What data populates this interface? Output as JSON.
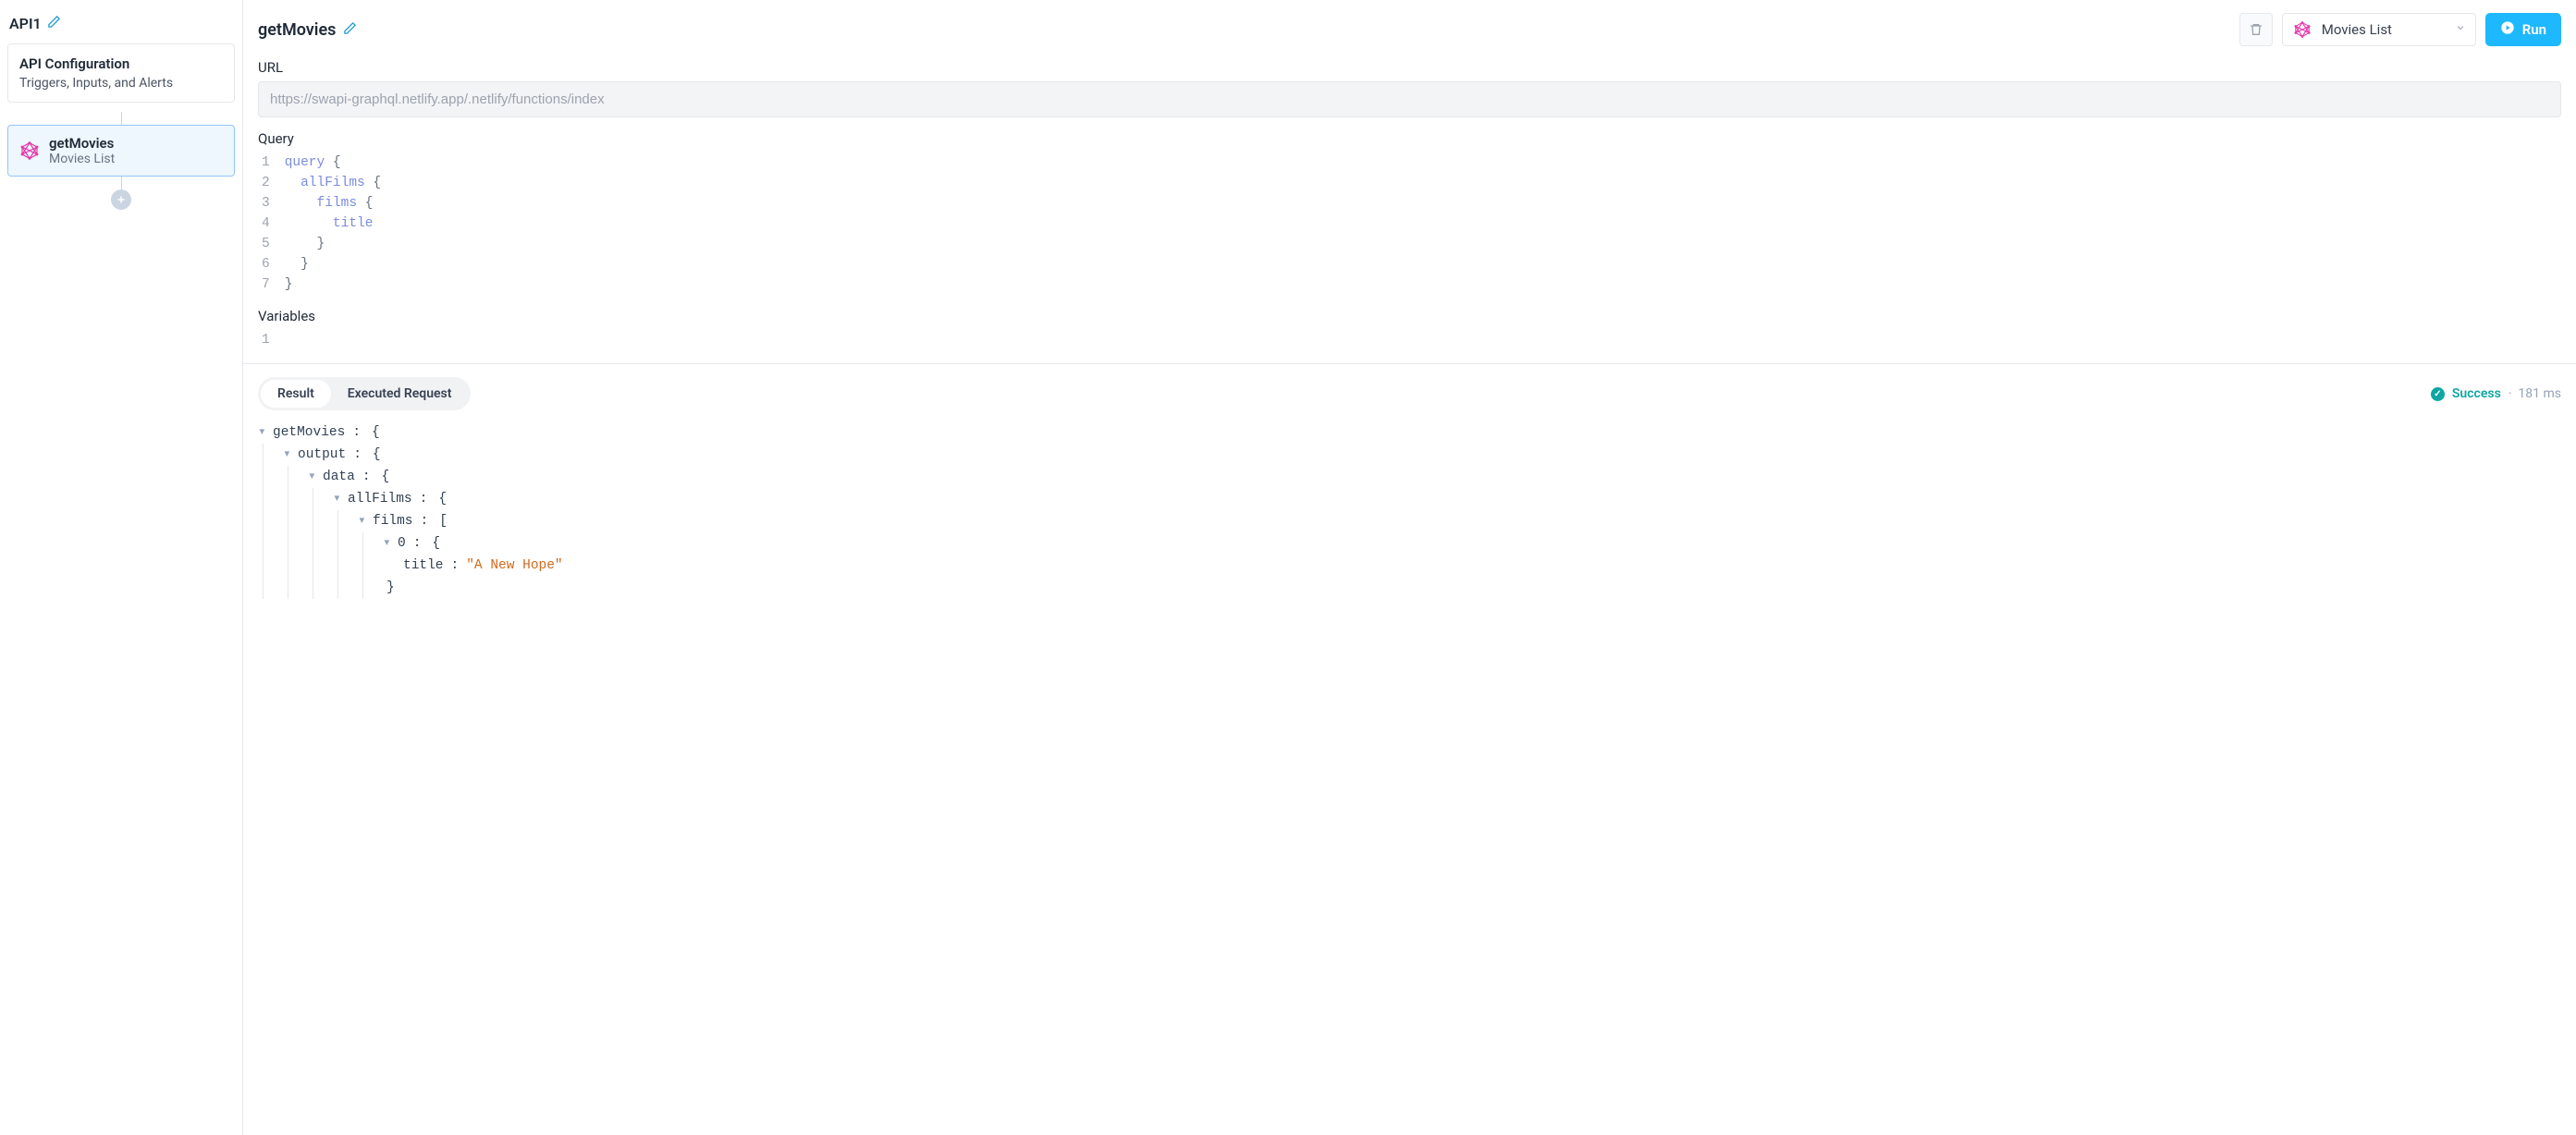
{
  "sidebar": {
    "api_name": "API1",
    "config_title": "API Configuration",
    "config_subtitle": "Triggers, Inputs, and Alerts",
    "node": {
      "title": "getMovies",
      "subtitle": "Movies List"
    }
  },
  "header": {
    "title": "getMovies",
    "select_value": "Movies List",
    "run_label": "Run"
  },
  "url": {
    "label": "URL",
    "value": "https://swapi-graphql.netlify.app/.netlify/functions/index"
  },
  "query": {
    "label": "Query",
    "lines": {
      "l1": {
        "num": "1",
        "kw": "query",
        "rest": " {"
      },
      "l2": {
        "num": "2",
        "indent": "  ",
        "name": "allFilms",
        "rest": " {"
      },
      "l3": {
        "num": "3",
        "indent": "    ",
        "name": "films",
        "rest": " {"
      },
      "l4": {
        "num": "4",
        "indent": "      ",
        "name": "title",
        "rest": ""
      },
      "l5": {
        "num": "5",
        "indent": "    ",
        "rest": "}"
      },
      "l6": {
        "num": "6",
        "indent": "  ",
        "rest": "}"
      },
      "l7": {
        "num": "7",
        "rest": "}"
      }
    }
  },
  "variables": {
    "label": "Variables",
    "line1_num": "1"
  },
  "result": {
    "tab_result": "Result",
    "tab_executed": "Executed Request",
    "status_label": "Success",
    "status_sep": "·",
    "status_time": "181 ms",
    "tree": {
      "root_key": "getMovies",
      "output_key": "output",
      "data_key": "data",
      "allFilms_key": "allFilms",
      "films_key": "films",
      "idx0": "0",
      "title_key": "title",
      "title_val": "\"A New Hope\""
    }
  }
}
